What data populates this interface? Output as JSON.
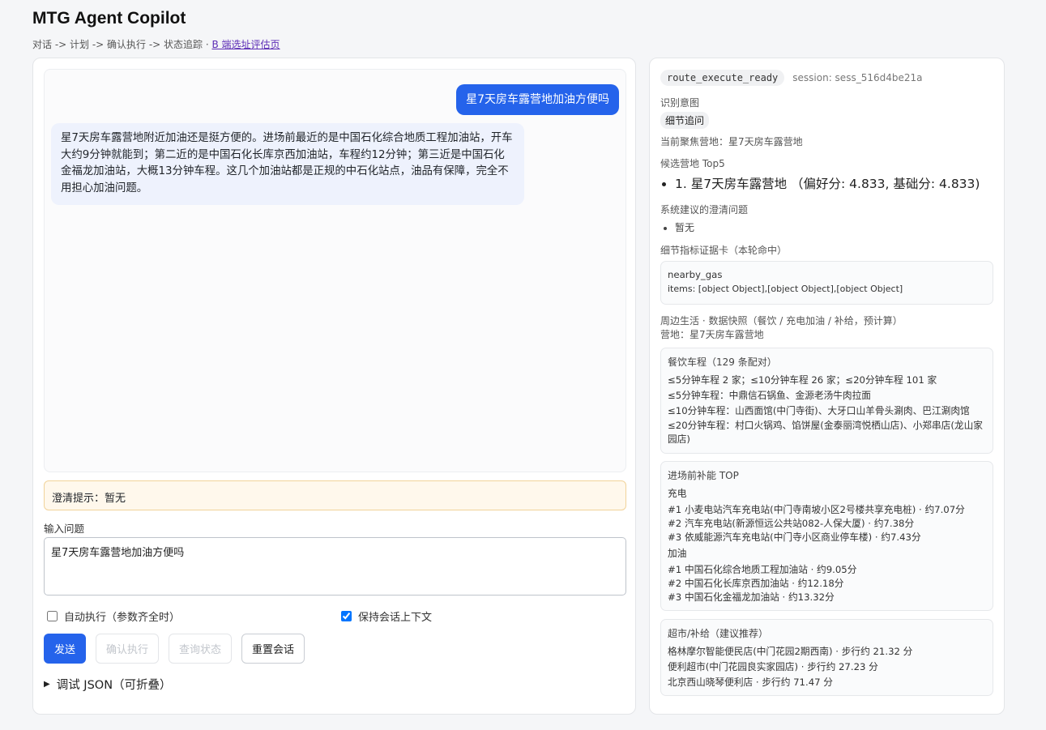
{
  "app": {
    "title": "MTG Agent Copilot",
    "nav_text": "对话 -> 计划 -> 确认执行 -> 状态追踪 · ",
    "nav_link": "B 端选址评估页"
  },
  "chat": {
    "user_message": "星7天房车露营地加油方便吗",
    "bot_message": "星7天房车露营地附近加油还是挺方便的。进场前最近的是中国石化综合地质工程加油站，开车大约9分钟就能到；第二近的是中国石化长库京西加油站，车程约12分钟；第三近是中国石化金福龙加油站，大概13分钟车程。这几个加油站都是正规的中石化站点，油品有保障，完全不用担心加油问题。"
  },
  "clarify": {
    "text": "澄清提示：暂无"
  },
  "input": {
    "label": "输入问题",
    "value": "星7天房车露营地加油方便吗"
  },
  "options": {
    "auto_execute": {
      "label": "自动执行（参数齐全时）",
      "checked": false
    },
    "keep_context": {
      "label": "保持会话上下文",
      "checked": true
    }
  },
  "buttons": {
    "send": "发送",
    "confirm": "确认执行",
    "query_status": "查询状态",
    "reset": "重置会话"
  },
  "debug": {
    "label": "调试 JSON（可折叠）"
  },
  "status": {
    "state": "route_execute_ready",
    "session": "session: sess_516d4be21a"
  },
  "intent": {
    "label": "识别意图",
    "value": "细节追问"
  },
  "focus": {
    "text": "当前聚焦营地：星7天房车露营地"
  },
  "candidates": {
    "label": "候选营地 Top5",
    "items": [
      "1. 星7天房车露营地 （偏好分: 4.833, 基础分: 4.833)"
    ]
  },
  "suggested_clarify": {
    "label": "系统建议的澄清问题",
    "items": [
      "暂无"
    ]
  },
  "evidence": {
    "label": "细节指标证据卡（本轮命中）",
    "key": "nearby_gas",
    "items_text": "items: [object Object],[object Object],[object Object]"
  },
  "snapshot": {
    "label": "周边生活 · 数据快照（餐饮 / 充电加油 / 补给，预计算）",
    "camp": "营地：星7天房车露营地"
  },
  "dining": {
    "title": "餐饮车程（129 条配对）",
    "lines": [
      "≤5分钟车程 2 家；≤10分钟车程 26 家；≤20分钟车程 101 家",
      "≤5分钟车程：中鼎信石锅鱼、金源老汤牛肉拉面",
      "≤10分钟车程：山西面馆(中门寺街)、大牙口山羊骨头涮肉、巴江涮肉馆",
      "≤20分钟车程：村口火锅鸡、馅饼屋(金泰丽湾悦栖山店)、小郑串店(龙山家园店)"
    ]
  },
  "energy": {
    "title": "进场前补能 TOP",
    "charge_label": "充电",
    "charge": [
      "#1 小麦电站汽车充电站(中门寺南坡小区2号楼共享充电桩) · 约7.07分",
      "#2 汽车充电站(新源恒远公共站082-人保大厦) · 约7.38分",
      "#3 依威能源汽车充电站(中门寺小区商业停车楼) · 约7.43分"
    ],
    "gas_label": "加油",
    "gas": [
      "#1 中国石化综合地质工程加油站 · 约9.05分",
      "#2 中国石化长库京西加油站 · 约12.18分",
      "#3 中国石化金福龙加油站 · 约13.32分"
    ]
  },
  "supermarket": {
    "title": "超市/补给（建议推荐）",
    "lines": [
      "格林摩尔智能便民店(中门花园2期西南) · 步行约 21.32 分",
      "便利超市(中门花园良实家园店) · 步行约 27.23 分",
      "北京西山晓琴便利店 · 步行约 71.47 分"
    ]
  },
  "colors": {
    "primary": "#2563eb",
    "bot_bubble": "#eef2fd",
    "clarify_bg": "#fff8ec",
    "clarify_border": "#f1d39a",
    "link": "#5b2bb5"
  }
}
